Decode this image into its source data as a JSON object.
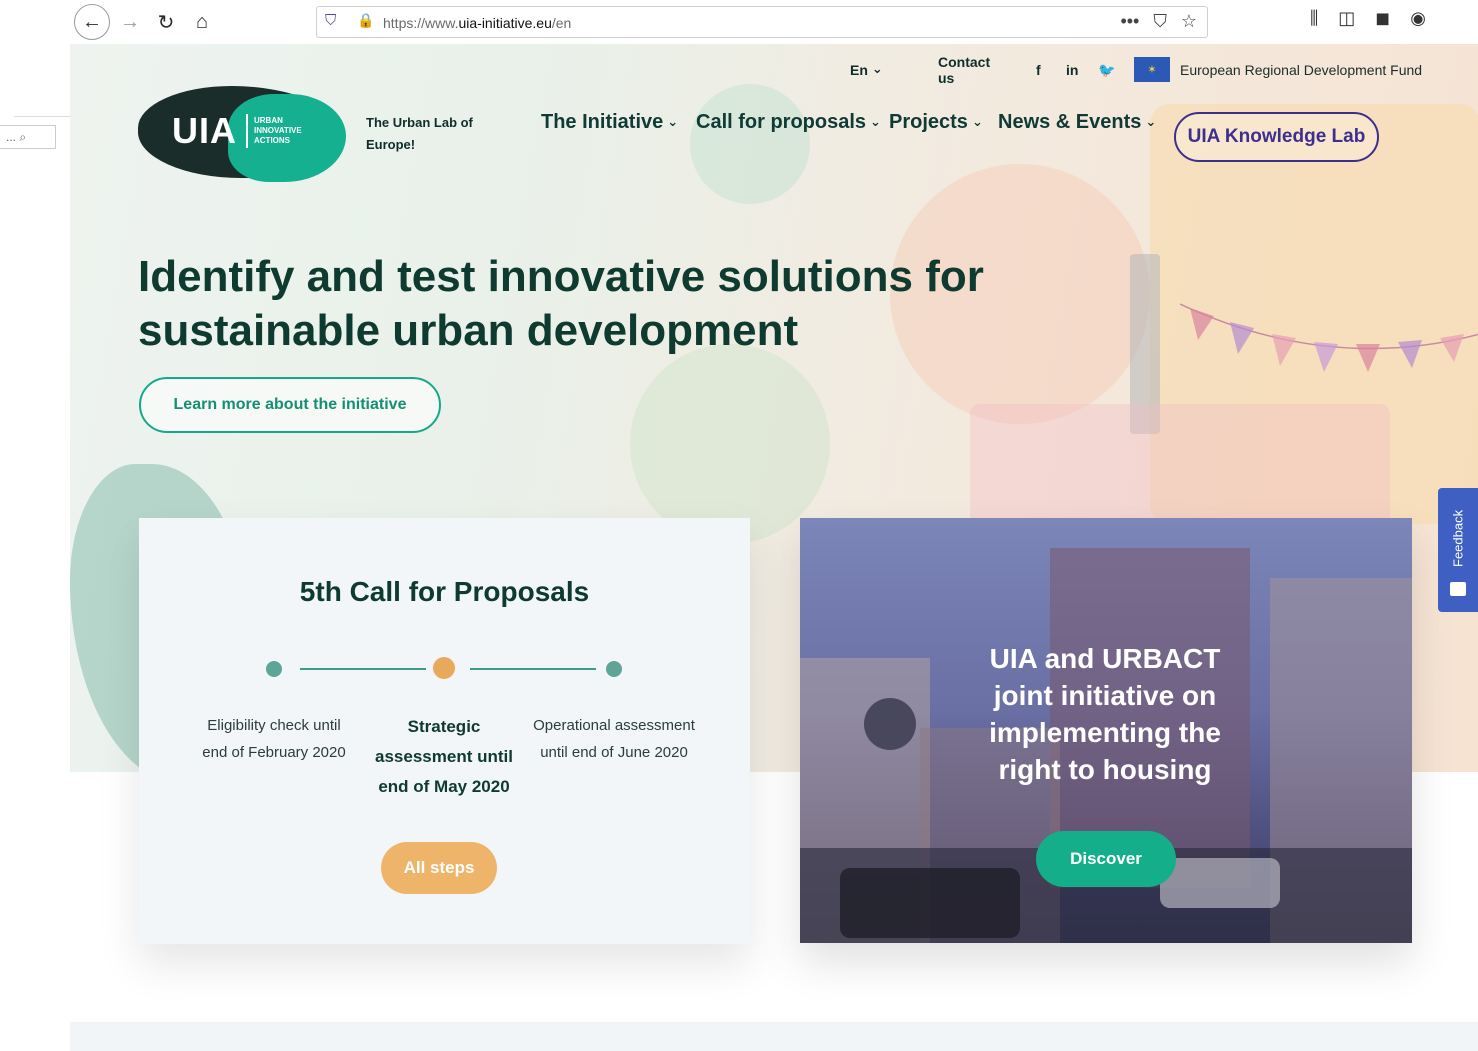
{
  "browser": {
    "url_prefix": "https://www.",
    "url_domain": "uia-initiative.eu",
    "url_suffix": "/en",
    "side_search": "... ⌕"
  },
  "header": {
    "lang": "En",
    "contact": "Contact us",
    "social": [
      "f",
      "in",
      "🐦"
    ],
    "erdf": "European Regional Development Fund",
    "logo_text": "UIA",
    "logo_small": "URBAN INNOVATIVE ACTIONS",
    "tagline": "The Urban Lab of Europe!",
    "nav": [
      "The Initiative",
      "Call for proposals",
      "Projects",
      "News & Events"
    ],
    "knowledge_lab": "UIA Knowledge Lab"
  },
  "hero": {
    "headline": "Identify and test innovative solutions for sustainable urban development",
    "cta": "Learn more about the initiative"
  },
  "call": {
    "title": "5th Call for Proposals",
    "steps": [
      "Eligibility check until end of February 2020",
      "Strategic assessment until end of May 2020",
      "Operational assessment until end of June 2020"
    ],
    "button": "All steps"
  },
  "housing": {
    "title": "UIA and URBACT joint initiative on implementing the right to housing",
    "button": "Discover"
  },
  "feedback": "Feedback",
  "colors": {
    "brand_teal": "#15ae8b",
    "brand_dark": "#0f3a30",
    "accent_purple": "#3e2f8f",
    "accent_orange": "#eeb46a"
  }
}
